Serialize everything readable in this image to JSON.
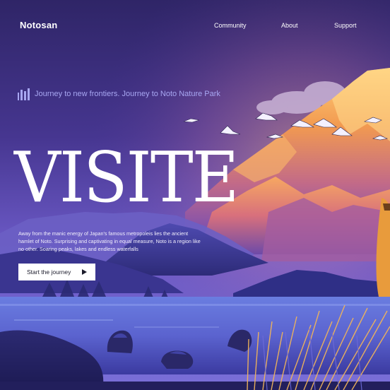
{
  "header": {
    "brand": "Notosan",
    "nav": {
      "community": "Community",
      "about": "About",
      "support": "Support"
    }
  },
  "hero": {
    "tagline_icon": "bars-icon",
    "tagline": "Journey to new frontiers. Journey to Noto Nature Park",
    "headline": "VISITE",
    "description": "Away from the manic energy of Japan's famous metropoleis  lies the ancient hamlet of Noto. Surprising and captivating in equal measure, Noto is a region like no other. Soaring peaks, lakes and endless waterfalls",
    "cta": {
      "label": "Start the journey",
      "icon": "play-arrow-icon"
    }
  },
  "colors": {
    "sky_top": "#3a2c78",
    "accent_orange": "#ee9646",
    "tagline_lavender": "#a8a7f2",
    "lake": "#5b63cf",
    "button_bg": "#ffffff"
  }
}
